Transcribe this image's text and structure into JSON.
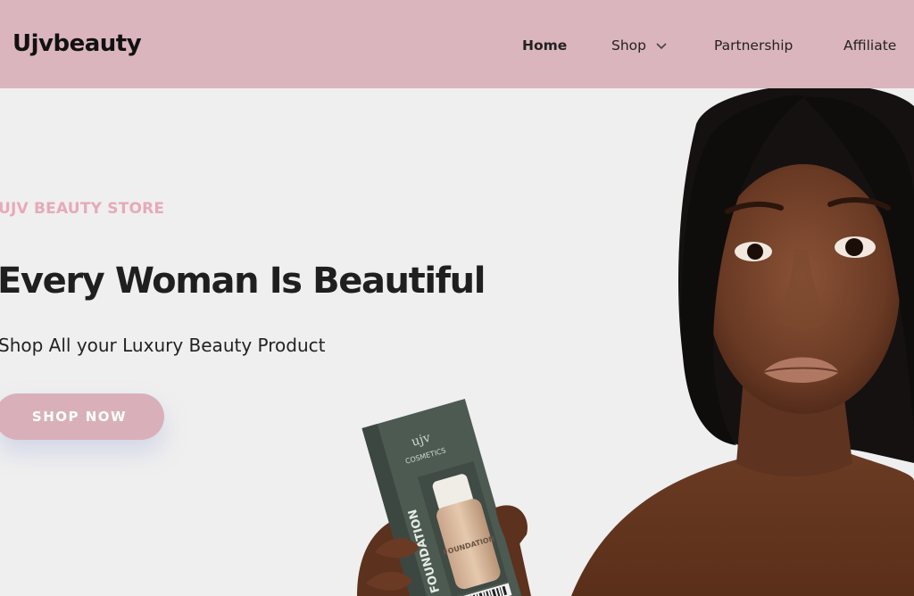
{
  "header": {
    "brand": "Ujvbeauty",
    "nav": {
      "home": "Home",
      "shop": "Shop",
      "partnership": "Partnership",
      "affiliate": "Affiliate"
    },
    "background_color": "#dbb5bd"
  },
  "hero": {
    "eyebrow": "UJV BEAUTY STORE",
    "headline": "Every Woman Is Beautiful",
    "subheadline": "Shop All your Luxury Beauty Product",
    "cta_label": "SHOP NOW",
    "accent_color": "#d9b0ba",
    "product": {
      "box_text_brand": "ujv",
      "box_text_line": "COSMETICS",
      "box_text_product": "FOUNDATION",
      "bottle_label": "FOUNDATION"
    }
  },
  "icons": {
    "shop_dropdown": "chevron-down-icon"
  }
}
